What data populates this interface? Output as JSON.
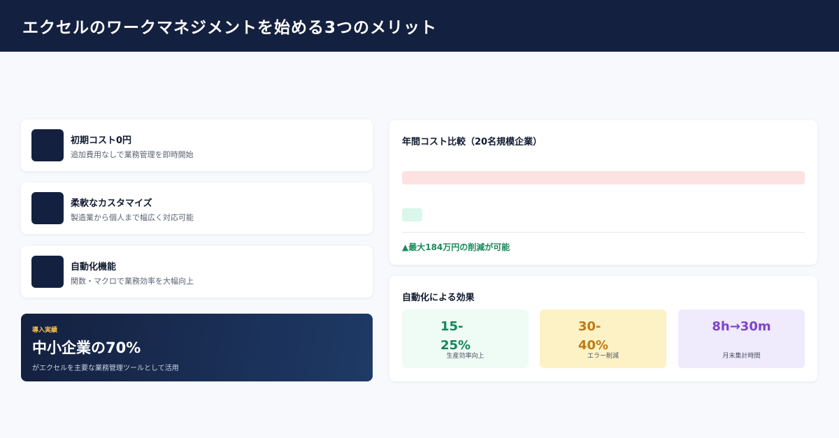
{
  "header": {
    "title": "エクセルのワークマネジメントを始める3つのメリット"
  },
  "features": [
    {
      "title": "初期コスト0円",
      "description": "追加費用なしで業務管理を即時開始"
    },
    {
      "title": "柔軟なカスタマイズ",
      "description": "製造業から個人まで幅広く対応可能"
    },
    {
      "title": "自動化機能",
      "description": "関数・マクロで業務効率を大幅向上"
    }
  ],
  "stat_banner": {
    "eyebrow": "導入実績",
    "value": "中小企業の70%",
    "description": "がエクセルを主要な業務管理ツールとして活用"
  },
  "cost_comparison": {
    "title": "年間コスト比較（20名規模企業）",
    "bar_fractions": [
      1.0,
      0.05
    ],
    "saving_note": "▲最大184万円の削減が可能"
  },
  "automation_effects": {
    "title": "自動化による効果",
    "items": [
      {
        "value": "15-25%",
        "label": "生産効率向上"
      },
      {
        "value": "30-40%",
        "label": "エラー削減"
      },
      {
        "value": "8h→30m",
        "label": "月末集計時間"
      }
    ]
  }
}
